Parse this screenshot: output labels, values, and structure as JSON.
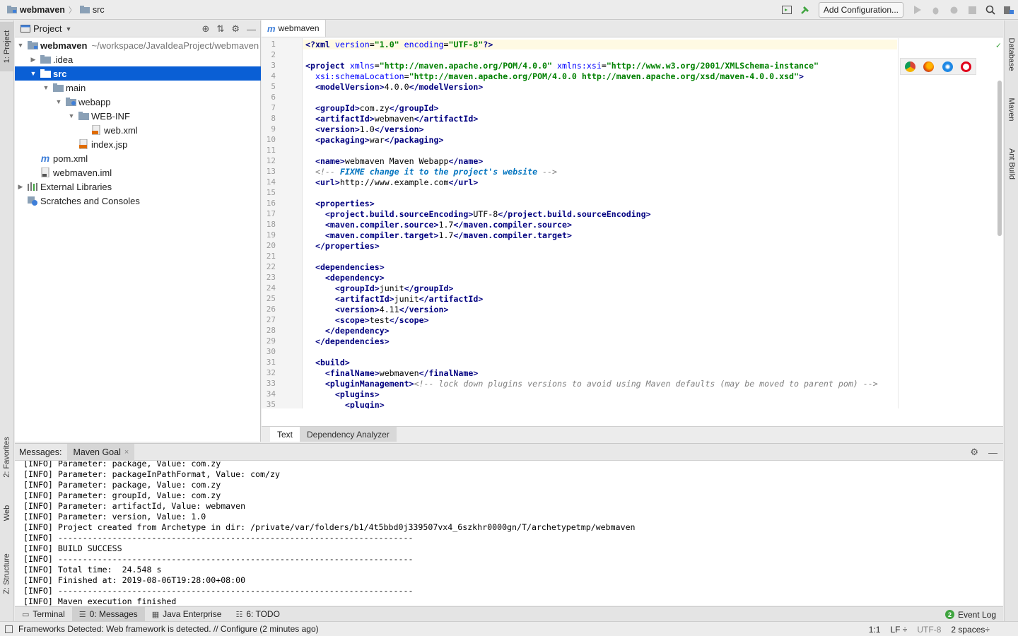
{
  "breadcrumb": {
    "project": "webmaven",
    "folder": "src"
  },
  "toolbar": {
    "add_config_label": "Add Configuration..."
  },
  "left_tabs": {
    "project": "1: Project",
    "favorites": "2: Favorites",
    "web": "Web",
    "structure": "Z: Structure"
  },
  "right_tabs": {
    "database": "Database",
    "maven": "Maven",
    "ant": "Ant Build"
  },
  "project_panel": {
    "title": "Project",
    "tree": [
      {
        "label": "webmaven",
        "path": "~/workspace/JavaIdeaProject/webmaven",
        "depth": 0,
        "arrow": "▼",
        "icon": "module-folder-icon",
        "bold": true
      },
      {
        "label": ".idea",
        "depth": 1,
        "arrow": "▶",
        "icon": "folder-icon"
      },
      {
        "label": "src",
        "depth": 1,
        "arrow": "▼",
        "icon": "folder-icon",
        "selected": true,
        "bold": true
      },
      {
        "label": "main",
        "depth": 2,
        "arrow": "▼",
        "icon": "folder-icon"
      },
      {
        "label": "webapp",
        "depth": 3,
        "arrow": "▼",
        "icon": "web-folder-icon"
      },
      {
        "label": "WEB-INF",
        "depth": 4,
        "arrow": "▼",
        "icon": "folder-icon"
      },
      {
        "label": "web.xml",
        "depth": 5,
        "arrow": "",
        "icon": "xml-file-icon"
      },
      {
        "label": "index.jsp",
        "depth": 4,
        "arrow": "",
        "icon": "jsp-file-icon"
      },
      {
        "label": "pom.xml",
        "depth": 1,
        "arrow": "",
        "icon": "maven-file-icon"
      },
      {
        "label": "webmaven.iml",
        "depth": 1,
        "arrow": "",
        "icon": "iml-file-icon"
      },
      {
        "label": "External Libraries",
        "depth": 0,
        "arrow": "▶",
        "icon": "libraries-icon"
      },
      {
        "label": "Scratches and Consoles",
        "depth": 0,
        "arrow": "",
        "icon": "scratches-icon"
      }
    ]
  },
  "editor": {
    "tab_label": "webmaven",
    "bottom_tabs": [
      "Text",
      "Dependency Analyzer"
    ],
    "lines": [
      "<?xml version=\"1.0\" encoding=\"UTF-8\"?>",
      "",
      "<project xmlns=\"http://maven.apache.org/POM/4.0.0\" xmlns:xsi=\"http://www.w3.org/2001/XMLSchema-instance\"",
      "  xsi:schemaLocation=\"http://maven.apache.org/POM/4.0.0 http://maven.apache.org/xsd/maven-4.0.0.xsd\">",
      "  <modelVersion>4.0.0</modelVersion>",
      "",
      "  <groupId>com.zy</groupId>",
      "  <artifactId>webmaven</artifactId>",
      "  <version>1.0</version>",
      "  <packaging>war</packaging>",
      "",
      "  <name>webmaven Maven Webapp</name>",
      "  <!-- FIXME change it to the project's website -->",
      "  <url>http://www.example.com</url>",
      "",
      "  <properties>",
      "    <project.build.sourceEncoding>UTF-8</project.build.sourceEncoding>",
      "    <maven.compiler.source>1.7</maven.compiler.source>",
      "    <maven.compiler.target>1.7</maven.compiler.target>",
      "  </properties>",
      "",
      "  <dependencies>",
      "    <dependency>",
      "      <groupId>junit</groupId>",
      "      <artifactId>junit</artifactId>",
      "      <version>4.11</version>",
      "      <scope>test</scope>",
      "    </dependency>",
      "  </dependencies>",
      "",
      "  <build>",
      "    <finalName>webmaven</finalName>",
      "    <pluginManagement><!-- lock down plugins versions to avoid using Maven defaults (may be moved to parent pom) -->",
      "      <plugins>",
      "        <plugin>"
    ]
  },
  "messages": {
    "label": "Messages:",
    "tab_label": "Maven Goal",
    "log": [
      "[INFO] Parameter: package, Value: com.zy",
      "[INFO] Parameter: packageInPathFormat, Value: com/zy",
      "[INFO] Parameter: package, Value: com.zy",
      "[INFO] Parameter: groupId, Value: com.zy",
      "[INFO] Parameter: artifactId, Value: webmaven",
      "[INFO] Parameter: version, Value: 1.0",
      "[INFO] Project created from Archetype in dir: /private/var/folders/b1/4t5bbd0j339507vx4_6szkhr0000gn/T/archetypetmp/webmaven",
      "[INFO] ------------------------------------------------------------------------",
      "[INFO] BUILD SUCCESS",
      "[INFO] ------------------------------------------------------------------------",
      "[INFO] Total time:  24.548 s",
      "[INFO] Finished at: 2019-08-06T19:28:00+08:00",
      "[INFO] ------------------------------------------------------------------------",
      "[INFO] Maven execution finished"
    ]
  },
  "tool_tabs": {
    "terminal": "Terminal",
    "messages": "0: Messages",
    "java_enterprise": "Java Enterprise",
    "todo": "6: TODO",
    "event_log": "Event Log"
  },
  "status": {
    "message": "Frameworks Detected: Web framework is detected. // Configure (2 minutes ago)",
    "position": "1:1",
    "line_sep": "LF ÷",
    "encoding": "UTF-8",
    "indent": "2 spaces÷"
  },
  "colors": {
    "selection": "#0a5fd5",
    "tag": "#000080",
    "attr": "#0000ff",
    "value": "#008000",
    "comment": "#808080"
  }
}
